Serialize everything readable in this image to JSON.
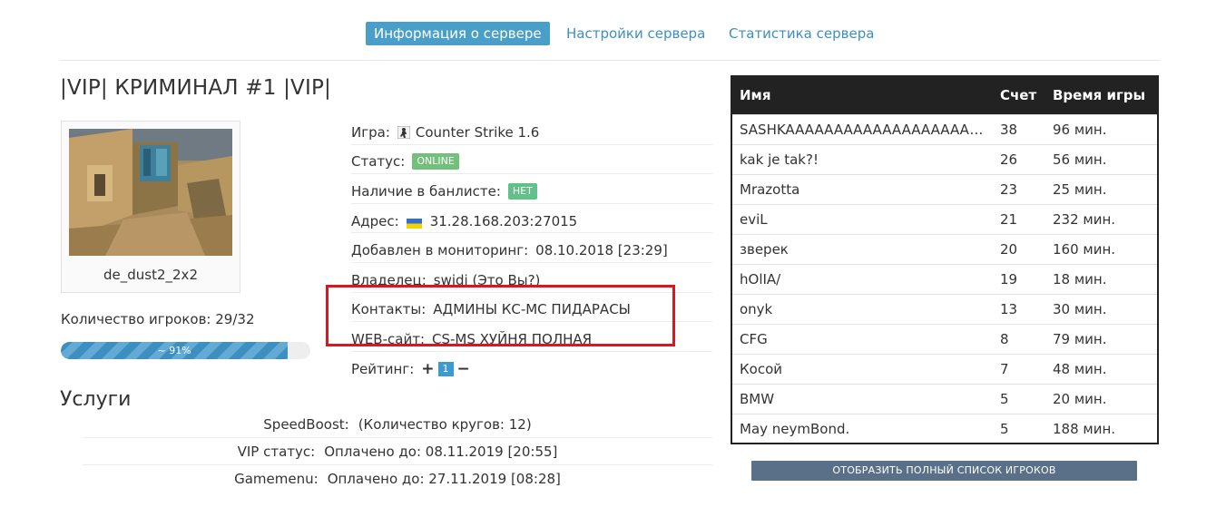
{
  "tabs": [
    {
      "label": "Информация о сервере",
      "active": true
    },
    {
      "label": "Настройки сервера",
      "active": false
    },
    {
      "label": "Статистика сервера",
      "active": false
    }
  ],
  "server": {
    "title": "|VIP| КРИМИНАЛ #1 |VIP|",
    "map_name": "de_dust2_2x2",
    "players_label": "Количество игроков:",
    "players_value": "29/32",
    "progress_label": "~ 91%",
    "progress_fraction": 0.91
  },
  "info": {
    "game_label": "Игра:",
    "game_value": "Counter Strike 1.6",
    "status_label": "Статус:",
    "status_value": "ONLINE",
    "banlist_label": "Наличие в банлисте:",
    "banlist_value": "НЕТ",
    "address_label": "Адрес:",
    "address_value": "31.28.168.203:27015",
    "added_label": "Добавлен в мониторинг:",
    "added_value": "08.10.2018 [23:29]",
    "owner_label": "Владелец:",
    "owner_value": "swidi (Это Вы?)",
    "contacts_label": "Контакты:",
    "contacts_value": "АДМИНЫ КС-МС ПИДАРАСЫ",
    "web_label": "WEB-сайт:",
    "web_value": "CS-MS ХУЙНЯ ПОЛНАЯ",
    "rating_label": "Рейтинг:",
    "rating_value": "1"
  },
  "services": {
    "title": "Услуги",
    "rows": [
      {
        "label": "SpeedBoost:",
        "value": "(Количество кругов: 12)"
      },
      {
        "label": "VIP статус:",
        "value": "Оплачено до: 08.11.2019 [20:55]"
      },
      {
        "label": "Gamemenu:",
        "value": "Оплачено до: 27.11.2019 [08:28]"
      }
    ]
  },
  "players_table": {
    "headers": {
      "name": "Имя",
      "score": "Счет",
      "time": "Время игры"
    },
    "rows": [
      {
        "name": "SASHKAAAAAAAAAAAAAAAAAAAAAAA...",
        "score": "38",
        "time": "96 мин."
      },
      {
        "name": "kak je tak?!",
        "score": "26",
        "time": "56 мин."
      },
      {
        "name": "Mrazotta",
        "score": "23",
        "time": "25 мин."
      },
      {
        "name": "eviL",
        "score": "21",
        "time": "232 мин."
      },
      {
        "name": "зверек",
        "score": "20",
        "time": "160 мин."
      },
      {
        "name": "hOlIA/",
        "score": "19",
        "time": "18 мин."
      },
      {
        "name": "onyk",
        "score": "13",
        "time": "30 мин."
      },
      {
        "name": "CFG",
        "score": "8",
        "time": "79 мин."
      },
      {
        "name": "Косой",
        "score": "7",
        "time": "48 мин."
      },
      {
        "name": "BMW",
        "score": "5",
        "time": "20 мин."
      },
      {
        "name": "May neymBond.",
        "score": "5",
        "time": "188 мин."
      }
    ],
    "full_list_button": "ОТОБРАЗИТЬ ПОЛНЫЙ СПИСОК ИГРОКОВ"
  },
  "colors": {
    "accent": "#4a9fc9",
    "online": "#72c07c",
    "highlight_box": "#e0141f",
    "table_header": "#222222",
    "button": "#5a7088"
  },
  "icons": {
    "game": "counter-strike-icon",
    "address": "ukraine-flag-icon",
    "rating_up": "plus-icon",
    "rating_down": "minus-icon"
  }
}
